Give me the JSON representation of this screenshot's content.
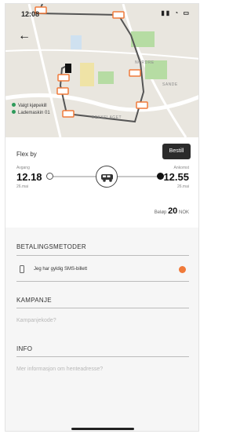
{
  "status": {
    "time": "12:08",
    "icons": "▮▮ ◔ ▭"
  },
  "nav": {
    "back": "←"
  },
  "map": {
    "legend": [
      {
        "label": "Valgt kjøpekill",
        "color": "#2e9a5a"
      },
      {
        "label": "Lademaskin 01",
        "color": "#2e9a5a"
      }
    ],
    "places": [
      "NORDRE",
      "BEKKELAGET",
      "SANDE"
    ],
    "colors": {
      "route": "#555555",
      "marker": "#f07a3a",
      "park": "#b6dca3",
      "water": "#cfe1f0",
      "road": "#ffffff"
    }
  },
  "trip": {
    "label": "Flex by",
    "order_button": "Bestill",
    "departure": {
      "caption": "Avgang",
      "time": "12.18",
      "date": "26.mai"
    },
    "arrival": {
      "caption": "Ankomst",
      "time": "12.55",
      "date": "26.mai"
    },
    "price": {
      "prefix": "Beløp",
      "amount": "20",
      "currency": "NOK"
    }
  },
  "payment": {
    "title": "BETALINGSMETODER",
    "option_label": "Jeg har gyldig SMS-billett",
    "selected": true,
    "accent": "#f07a3a"
  },
  "campaign": {
    "title": "KAMPANJE",
    "placeholder": "Kampanjekode?"
  },
  "info": {
    "title": "INFO",
    "placeholder": "Mer informasjon om henteadresse?"
  }
}
